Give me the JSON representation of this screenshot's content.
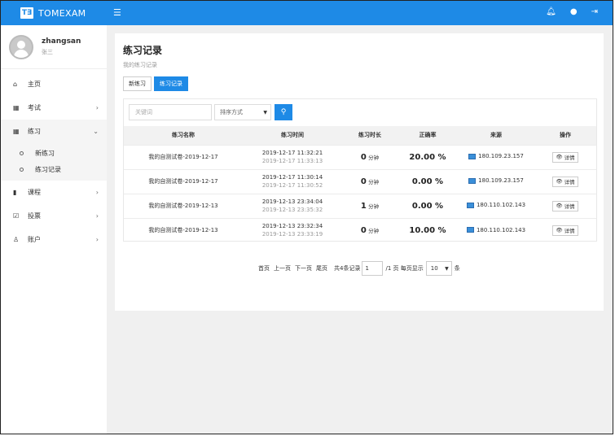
{
  "app": {
    "logo_text": "T∃",
    "name": "TOMEXAM"
  },
  "topbar": {
    "menu_icon": "hamburger-icon",
    "icons": [
      "bell-icon",
      "user-circle-icon",
      "logout-icon"
    ]
  },
  "user": {
    "username": "zhangsan",
    "display_name": "张三"
  },
  "sidebar": {
    "items": [
      {
        "label": "主页",
        "icon": "home-icon",
        "has_arrow": false
      },
      {
        "label": "考试",
        "icon": "calendar-icon",
        "has_arrow": true
      },
      {
        "label": "练习",
        "icon": "calendar-icon",
        "has_arrow": true,
        "open": true
      },
      {
        "label": "课程",
        "icon": "book-icon",
        "has_arrow": true
      },
      {
        "label": "投票",
        "icon": "checkbox-icon",
        "has_arrow": true
      },
      {
        "label": "账户",
        "icon": "user-icon",
        "has_arrow": true
      }
    ],
    "subitems": [
      "新练习",
      "练习记录"
    ]
  },
  "page": {
    "title": "练习记录",
    "subtitle": "我的练习记录",
    "tabs": [
      {
        "label": "新练习",
        "active": false
      },
      {
        "label": "练习记录",
        "active": true
      }
    ]
  },
  "search": {
    "keyword_placeholder": "关键词",
    "sort_label": "排序方式"
  },
  "table": {
    "headers": [
      "练习名称",
      "练习时间",
      "练习时长",
      "正确率",
      "来源",
      "操作"
    ],
    "rows": [
      {
        "name": "我的自测试卷-2019-12-17",
        "time_start": "2019-12-17 11:32:21",
        "time_end": "2019-12-17 11:33:13",
        "duration": "0",
        "duration_unit": "分钟",
        "accuracy": "20.00 %",
        "source": "180.109.23.157",
        "action": "详情"
      },
      {
        "name": "我的自测试卷-2019-12-17",
        "time_start": "2019-12-17 11:30:14",
        "time_end": "2019-12-17 11:30:52",
        "duration": "0",
        "duration_unit": "分钟",
        "accuracy": "0.00 %",
        "source": "180.109.23.157",
        "action": "详情"
      },
      {
        "name": "我的自测试卷-2019-12-13",
        "time_start": "2019-12-13 23:34:04",
        "time_end": "2019-12-13 23:35:32",
        "duration": "1",
        "duration_unit": "分钟",
        "accuracy": "0.00 %",
        "source": "180.110.102.143",
        "action": "详情"
      },
      {
        "name": "我的自测试卷-2019-12-13",
        "time_start": "2019-12-13 23:32:34",
        "time_end": "2019-12-13 23:33:19",
        "duration": "0",
        "duration_unit": "分钟",
        "accuracy": "10.00 %",
        "source": "180.110.102.143",
        "action": "详情"
      }
    ]
  },
  "pager": {
    "first": "首页",
    "prev": "上一页",
    "next": "下一页",
    "last": "尾页",
    "total": "共4条记录",
    "page_value": "1",
    "page_info": "/1 页 每页显示",
    "size_value": "10",
    "unit": "条"
  }
}
